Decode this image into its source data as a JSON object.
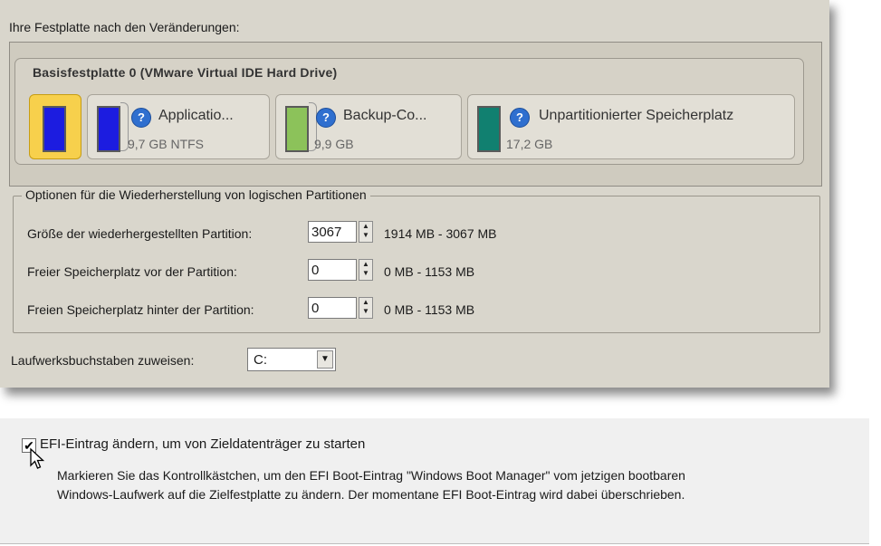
{
  "panel": {
    "title": "Ihre Festplatte nach den Veränderungen:",
    "disk_name": "Basisfestplatte 0 (VMware Virtual IDE Hard Drive)",
    "partitions": [
      {
        "name": "",
        "size": "",
        "color": "#1c1ce0",
        "selected": true
      },
      {
        "name": "Applicatio...",
        "size": "9,7 GB NTFS",
        "color": "#1c1ce0",
        "selected": false
      },
      {
        "name": "Backup-Co...",
        "size": "9,9 GB",
        "color": "#8cc25a",
        "selected": false
      },
      {
        "name": "Unpartitionierter Speicherplatz",
        "size": "17,2 GB",
        "color": "#118070",
        "selected": false
      }
    ]
  },
  "options": {
    "legend": "Optionen für die Wiederherstellung von logischen Partitionen",
    "rows": [
      {
        "label": "Größe der wiederhergestellten Partition:",
        "value": "3067",
        "range": "1914 MB - 3067 MB"
      },
      {
        "label": "Freier Speicherplatz vor der Partition:",
        "value": "0",
        "range": "0 MB - 1153 MB"
      },
      {
        "label": "Freien Speicherplatz hinter der Partition:",
        "value": "0",
        "range": "0 MB - 1153 MB"
      }
    ]
  },
  "drive": {
    "label": "Laufwerksbuchstaben zuweisen:",
    "value": "C:"
  },
  "efi": {
    "checked": true,
    "label": "EFI-Eintrag ändern, um von Zieldatenträger zu starten",
    "description_line1": "Markieren Sie das Kontrollkästchen, um den EFI Boot-Eintrag \"Windows Boot Manager\" vom jetzigen bootbaren",
    "description_line2": "Windows-Laufwerk auf die Zielfestplatte zu ändern. Der momentane EFI Boot-Eintrag wird dabei überschrieben."
  },
  "icons": {
    "help": "help-icon",
    "cursor": "mouse-pointer-icon",
    "check": "checkmark-icon"
  }
}
